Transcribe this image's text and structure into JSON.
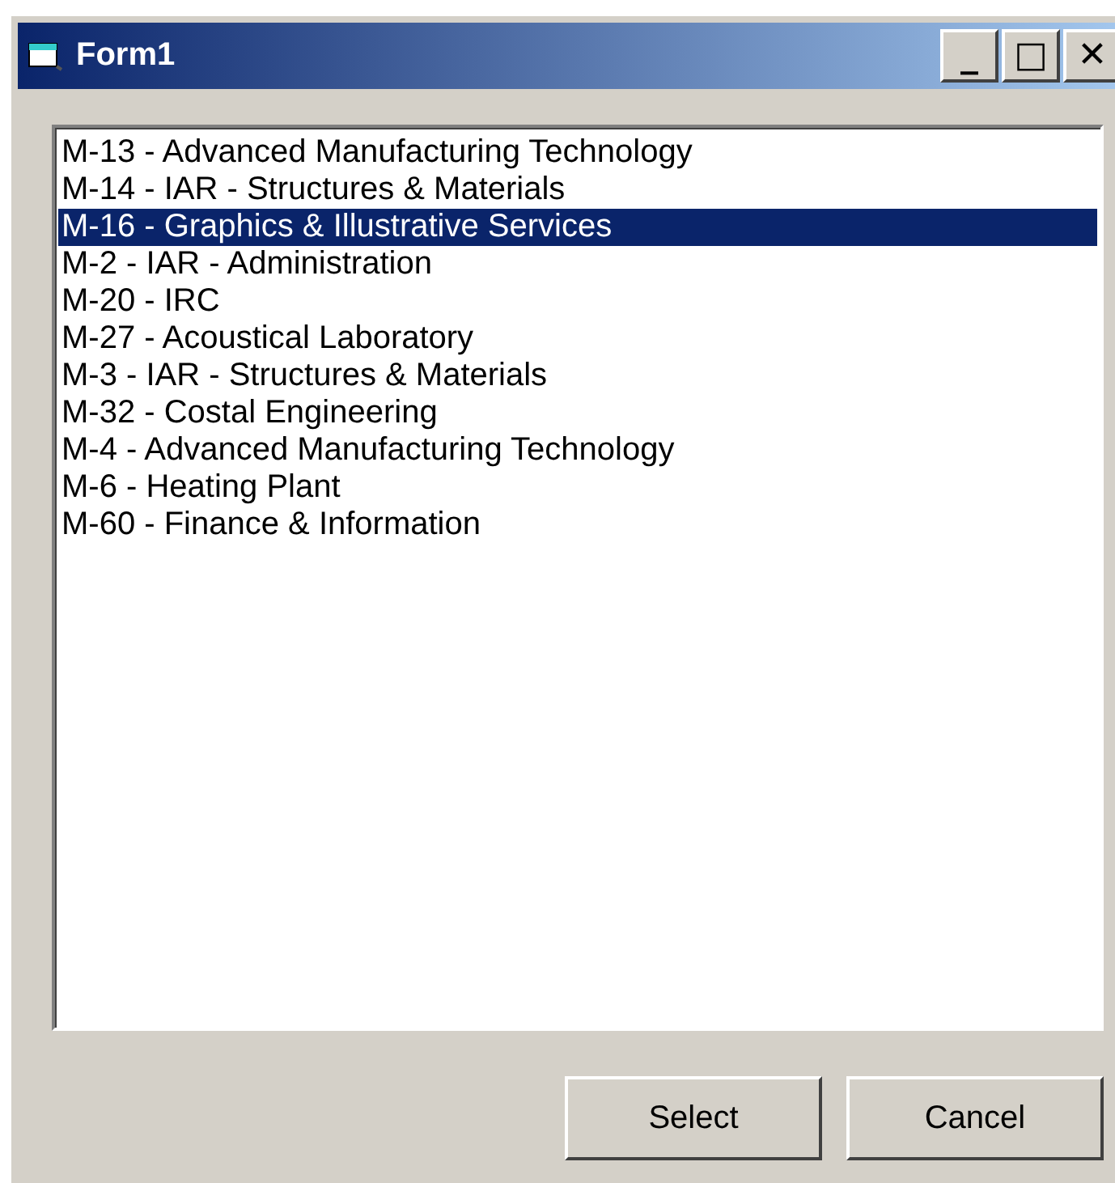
{
  "window": {
    "title": "Form1",
    "controls": [
      "_",
      "□",
      "✕"
    ]
  },
  "list": {
    "items": [
      {
        "label": "M-13 - Advanced Manufacturing Technology",
        "selected": false
      },
      {
        "label": "M-14 - IAR - Structures & Materials",
        "selected": false
      },
      {
        "label": "M-16 - Graphics & Illustrative Services",
        "selected": true
      },
      {
        "label": "M-2 - IAR - Administration",
        "selected": false
      },
      {
        "label": "M-20 - IRC",
        "selected": false
      },
      {
        "label": "M-27 - Acoustical Laboratory",
        "selected": false
      },
      {
        "label": "M-3 - IAR - Structures & Materials",
        "selected": false
      },
      {
        "label": "M-32 - Costal Engineering",
        "selected": false
      },
      {
        "label": "M-4 - Advanced Manufacturing Technology",
        "selected": false
      },
      {
        "label": "M-6 - Heating Plant",
        "selected": false
      },
      {
        "label": "M-60 - Finance & Information",
        "selected": false
      }
    ]
  },
  "buttons": [
    "Select",
    "Cancel"
  ]
}
